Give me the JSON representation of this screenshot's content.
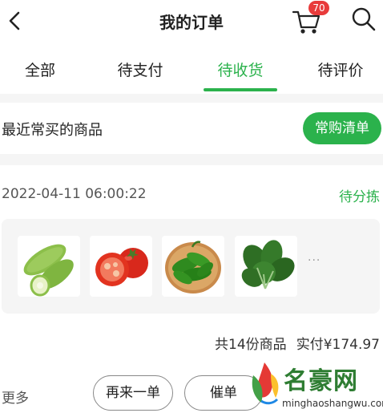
{
  "header": {
    "title": "我的订单",
    "cart_badge": "70"
  },
  "tabs": [
    {
      "label": "全部",
      "active": false
    },
    {
      "label": "待支付",
      "active": false
    },
    {
      "label": "待收货",
      "active": true
    },
    {
      "label": "待评价",
      "active": false
    }
  ],
  "recent": {
    "label": "最近常买的商品",
    "button_label": "常购清单"
  },
  "order": {
    "datetime": "2022-04-11 06:00:22",
    "status": "待分拣",
    "products": [
      "zucchini",
      "tomato",
      "green-pepper",
      "spinach"
    ],
    "more_indicator": "···",
    "item_count_text": "共14份商品",
    "paid_label": "实付",
    "paid_amount": "¥174.97"
  },
  "actions": {
    "more_label": "更多",
    "reorder_label": "再来一单",
    "urge_label": "催单"
  },
  "watermark": {
    "brand": "名豪网",
    "url": "minghaoshangwu.com"
  },
  "colors": {
    "accent": "#2bb24c",
    "badge": "#e83b3b",
    "background": "#f5f5f5"
  }
}
